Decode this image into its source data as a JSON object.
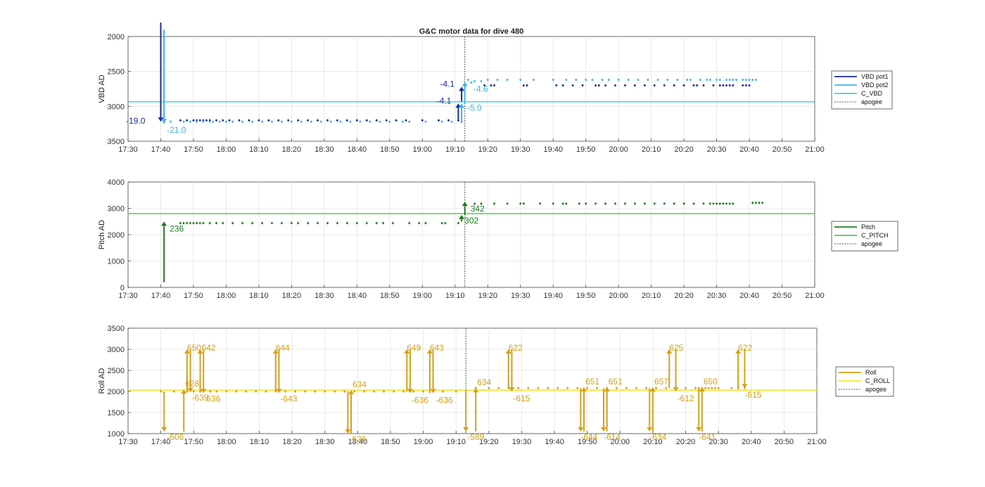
{
  "figure_title": "G&C motor data for dive 480",
  "chart_data": [
    {
      "type": "scatter",
      "ylabel": "VBD AD",
      "ylim": [
        2000,
        3500
      ],
      "y_reversed": true,
      "yticks": [
        "2000",
        "2500",
        "3000",
        "3500"
      ],
      "xticks": [
        "17:30",
        "17:40",
        "17:50",
        "18:00",
        "18:10",
        "18:20",
        "18:30",
        "18:40",
        "18:50",
        "19:00",
        "19:10",
        "19:20",
        "19:30",
        "19:40",
        "19:50",
        "20:00",
        "20:10",
        "20:20",
        "20:30",
        "20:40",
        "20:50",
        "21:00"
      ],
      "xlim_minutes": [
        1050,
        1260
      ],
      "grid": true,
      "legend_entries": [
        "VBD pot1",
        "VBD pot2",
        "C_VBD",
        "apogee"
      ],
      "colors": {
        "pot1": "#1b2aa0",
        "pot2": "#3ab7e8",
        "c": "#47d1d8",
        "apogee": "#555555"
      },
      "c_value": 2935,
      "apogee_minutes": 1153,
      "pot1": {
        "x": [
          1066,
          1068,
          1070,
          1071,
          1072,
          1073,
          1074,
          1075,
          1077,
          1079,
          1081,
          1084,
          1087,
          1090,
          1093,
          1096,
          1099,
          1102,
          1105,
          1108,
          1111,
          1114,
          1117,
          1120,
          1123,
          1126,
          1129,
          1132,
          1135,
          1140,
          1145,
          1148,
          1151,
          1159,
          1161,
          1162,
          1171,
          1172,
          1181,
          1183,
          1186,
          1189,
          1193,
          1194,
          1196,
          1199,
          1202,
          1205,
          1208,
          1211,
          1214,
          1217,
          1220,
          1223,
          1224,
          1226,
          1229,
          1231,
          1232,
          1233,
          1234,
          1235,
          1238,
          1239,
          1240
        ],
        "y": [
          3200,
          3200,
          3200,
          3200,
          3200,
          3200,
          3200,
          3200,
          3200,
          3200,
          3200,
          3200,
          3200,
          3200,
          3200,
          3200,
          3200,
          3200,
          3200,
          3200,
          3200,
          3200,
          3200,
          3200,
          3200,
          3200,
          3200,
          3200,
          3200,
          3200,
          3200,
          3200,
          3200,
          2700,
          2700,
          2700,
          2700,
          2700,
          2700,
          2700,
          2700,
          2700,
          2700,
          2700,
          2700,
          2700,
          2700,
          2700,
          2700,
          2700,
          2700,
          2700,
          2700,
          2700,
          2700,
          2700,
          2700,
          2700,
          2700,
          2700,
          2700,
          2700,
          2700,
          2700,
          2700
        ]
      },
      "pot2": {
        "x": [
          1061,
          1063,
          1067,
          1069,
          1071,
          1073,
          1075,
          1076,
          1078,
          1080,
          1082,
          1085,
          1088,
          1091,
          1094,
          1097,
          1100,
          1103,
          1106,
          1109,
          1112,
          1115,
          1118,
          1121,
          1124,
          1127,
          1130,
          1134,
          1136,
          1141,
          1146,
          1149,
          1152,
          1154,
          1155,
          1156,
          1158,
          1160,
          1163,
          1166,
          1170,
          1174,
          1180,
          1184,
          1187,
          1190,
          1192,
          1195,
          1197,
          1200,
          1203,
          1206,
          1209,
          1212,
          1215,
          1218,
          1221,
          1222,
          1225,
          1227,
          1228,
          1230,
          1231,
          1233,
          1234,
          1235,
          1236,
          1238,
          1239,
          1240,
          1241,
          1242
        ],
        "y": [
          3230,
          3220,
          3220,
          3220,
          3220,
          3220,
          3220,
          3220,
          3220,
          3220,
          3220,
          3220,
          3220,
          3220,
          3220,
          3220,
          3220,
          3220,
          3220,
          3220,
          3220,
          3220,
          3220,
          3220,
          3220,
          3220,
          3220,
          3220,
          3220,
          3220,
          3220,
          3220,
          3220,
          2620,
          2660,
          2640,
          2640,
          2620,
          2620,
          2620,
          2620,
          2620,
          2620,
          2620,
          2620,
          2620,
          2620,
          2620,
          2620,
          2620,
          2620,
          2620,
          2620,
          2620,
          2620,
          2620,
          2620,
          2620,
          2620,
          2620,
          2620,
          2620,
          2620,
          2620,
          2620,
          2620,
          2620,
          2620,
          2620,
          2620,
          2620,
          2620
        ]
      },
      "moves": [
        {
          "series": "pot1",
          "x": 1060,
          "from": 1800,
          "to": 3220,
          "label": "-19.0",
          "lx": -22,
          "ly": 3,
          "anchor": "end"
        },
        {
          "series": "pot2",
          "x": 1061,
          "from": 1900,
          "to": 3240,
          "label": "-21.0",
          "lx": 4,
          "ly": 14,
          "anchor": "start"
        },
        {
          "series": "pot1",
          "x": 1151,
          "from": 3200,
          "to": 2960,
          "label": "-4.1",
          "lx": -10,
          "ly": 0,
          "anchor": "end"
        },
        {
          "series": "pot1",
          "x": 1152,
          "from": 2930,
          "to": 2720,
          "label": "-4.1",
          "lx": -10,
          "ly": 0,
          "anchor": "end"
        },
        {
          "series": "pot2",
          "x": 1152,
          "from": 3240,
          "to": 2960,
          "label": "-5.0",
          "lx": 8,
          "ly": 10,
          "anchor": "start"
        },
        {
          "series": "pot2",
          "x": 1153,
          "from": 2960,
          "to": 2650,
          "label": "-4.6",
          "lx": 12,
          "ly": 14,
          "anchor": "start"
        }
      ]
    },
    {
      "type": "scatter",
      "ylabel": "Pitch AD",
      "ylim": [
        0,
        4000
      ],
      "yticks": [
        "0",
        "1000",
        "2000",
        "3000",
        "4000"
      ],
      "xticks": [
        "17:30",
        "17:40",
        "17:50",
        "18:00",
        "18:10",
        "18:20",
        "18:30",
        "18:40",
        "18:50",
        "19:00",
        "19:10",
        "19:20",
        "19:30",
        "19:40",
        "19:50",
        "20:00",
        "20:10",
        "20:20",
        "20:30",
        "20:40",
        "20:50",
        "21:00"
      ],
      "xlim_minutes": [
        1050,
        1260
      ],
      "grid": true,
      "legend_entries": [
        "Pitch",
        "C_PITCH",
        "apogee"
      ],
      "colors": {
        "pitch": "#1e7d1e",
        "c": "#4fd14f",
        "apogee": "#555555"
      },
      "c_value": 2800,
      "apogee_minutes": 1153,
      "pitch": {
        "x": [
          1066,
          1067,
          1068,
          1069,
          1070,
          1071,
          1072,
          1073,
          1075,
          1077,
          1079,
          1082,
          1085,
          1088,
          1091,
          1094,
          1097,
          1100,
          1102,
          1105,
          1108,
          1111,
          1114,
          1117,
          1120,
          1123,
          1126,
          1128,
          1131,
          1136,
          1139,
          1141,
          1146,
          1147,
          1151,
          1156,
          1158,
          1162,
          1166,
          1170,
          1171,
          1176,
          1180,
          1183,
          1184,
          1188,
          1190,
          1193,
          1196,
          1199,
          1202,
          1205,
          1208,
          1211,
          1214,
          1217,
          1220,
          1223,
          1226,
          1228,
          1229,
          1230,
          1231,
          1232,
          1233,
          1234,
          1235,
          1241,
          1242,
          1243,
          1244
        ],
        "y": [
          2440,
          2440,
          2440,
          2440,
          2440,
          2440,
          2440,
          2440,
          2440,
          2440,
          2440,
          2440,
          2440,
          2440,
          2440,
          2440,
          2440,
          2440,
          2440,
          2440,
          2440,
          2440,
          2440,
          2440,
          2440,
          2440,
          2440,
          2440,
          2440,
          2440,
          2440,
          2440,
          2440,
          2440,
          2440,
          3180,
          3180,
          3180,
          3180,
          3180,
          3180,
          3180,
          3180,
          3180,
          3180,
          3180,
          3180,
          3180,
          3180,
          3180,
          3180,
          3180,
          3180,
          3180,
          3180,
          3180,
          3180,
          3180,
          3180,
          3180,
          3180,
          3180,
          3180,
          3180,
          3180,
          3180,
          3180,
          3210,
          3210,
          3210,
          3210
        ]
      },
      "moves": [
        {
          "x": 1061,
          "from": 200,
          "to": 2500,
          "label": "236",
          "lx": 8,
          "ly": 14,
          "anchor": "start"
        },
        {
          "x": 1152,
          "from": 2500,
          "to": 2750,
          "label": "302",
          "lx": 4,
          "ly": 12,
          "anchor": "start"
        },
        {
          "x": 1153,
          "from": 2750,
          "to": 3250,
          "label": "342",
          "lx": 8,
          "ly": 14,
          "anchor": "start"
        }
      ]
    },
    {
      "type": "scatter",
      "ylabel": "Roll AD",
      "ylim": [
        1000,
        3500
      ],
      "yticks": [
        "1000",
        "1500",
        "2000",
        "2500",
        "3000",
        "3500"
      ],
      "xticks": [
        "17:30",
        "17:40",
        "17:50",
        "18:00",
        "18:10",
        "18:20",
        "18:30",
        "18:40",
        "18:50",
        "19:00",
        "19:10",
        "19:20",
        "19:30",
        "19:40",
        "19:50",
        "20:00",
        "20:10",
        "20:20",
        "20:30",
        "20:40",
        "20:50",
        "21:00"
      ],
      "xlim_minutes": [
        1050,
        1260
      ],
      "grid": true,
      "legend_entries": [
        "Roll",
        "C_ROLL",
        "apogee"
      ],
      "colors": {
        "roll": "#d4a017",
        "c": "#f2e640",
        "apogee": "#555555"
      },
      "c_value": 2030,
      "apogee_minutes": 1153,
      "roll": {
        "x": [
          1060,
          1064,
          1068,
          1070,
          1072,
          1075,
          1077,
          1080,
          1083,
          1086,
          1089,
          1092,
          1095,
          1098,
          1101,
          1104,
          1107,
          1110,
          1113,
          1116,
          1119,
          1122,
          1125,
          1128,
          1131,
          1134,
          1137,
          1140,
          1143,
          1146,
          1150,
          1156,
          1160,
          1163,
          1166,
          1169,
          1172,
          1175,
          1178,
          1181,
          1184,
          1187,
          1190,
          1193,
          1196,
          1199,
          1202,
          1205,
          1208,
          1211,
          1214,
          1217,
          1220,
          1223,
          1224,
          1225,
          1226,
          1227,
          1228,
          1229,
          1230,
          1234,
          1236,
          1238
        ],
        "y": [
          2000,
          2000,
          2000,
          2000,
          2000,
          2000,
          2000,
          2000,
          2000,
          2000,
          2000,
          2000,
          2000,
          2000,
          2000,
          2000,
          2000,
          2000,
          2000,
          2000,
          2000,
          2000,
          2000,
          2000,
          2000,
          2000,
          2000,
          2000,
          2000,
          2000,
          2000,
          2080,
          2080,
          2080,
          2080,
          2080,
          2080,
          2080,
          2080,
          2080,
          2080,
          2080,
          2080,
          2080,
          2080,
          2080,
          2080,
          2080,
          2080,
          2080,
          2080,
          2080,
          2080,
          2080,
          2080,
          2080,
          2080,
          2080,
          2080,
          2080,
          2080,
          2080,
          2080,
          2080
        ]
      },
      "moves": [
        {
          "x": 1061,
          "from": 2000,
          "to": 1050,
          "label": "-606",
          "lx": 4,
          "ly": 12,
          "anchor": "start"
        },
        {
          "x": 1067,
          "from": 1050,
          "to": 2050,
          "label": "628",
          "lx": 2,
          "ly": -4,
          "anchor": "start"
        },
        {
          "x": 1068,
          "from": 2000,
          "to": 3000,
          "label": "650",
          "lx": 0,
          "ly": 2,
          "anchor": "start"
        },
        {
          "x": 1069,
          "from": 3000,
          "to": 1980,
          "label": "-639",
          "lx": 2,
          "ly": 12,
          "anchor": "start"
        },
        {
          "x": 1072,
          "from": 1980,
          "to": 3000,
          "label": "642",
          "lx": 2,
          "ly": 2,
          "anchor": "start"
        },
        {
          "x": 1073,
          "from": 3000,
          "to": 1960,
          "label": "636",
          "lx": 4,
          "ly": 12,
          "anchor": "start"
        },
        {
          "x": 1080,
          "from": 0,
          "to": 0,
          "label": "",
          "lx": 0,
          "ly": 0,
          "anchor": "start",
          "skip": true
        },
        {
          "x": 1095,
          "from": 2000,
          "to": 3000,
          "label": "644",
          "lx": 0,
          "ly": 2,
          "anchor": "start"
        },
        {
          "x": 1096,
          "from": 3000,
          "to": 1960,
          "label": "-643",
          "lx": 2,
          "ly": 12,
          "anchor": "start"
        },
        {
          "x": 1117,
          "from": 2000,
          "to": 1000,
          "label": "-626",
          "lx": 2,
          "ly": 12,
          "anchor": "start"
        },
        {
          "x": 1118,
          "from": 1000,
          "to": 2030,
          "label": "634",
          "lx": 2,
          "ly": -4,
          "anchor": "start"
        },
        {
          "x": 1135,
          "from": 2000,
          "to": 3000,
          "label": "649",
          "lx": 0,
          "ly": 2,
          "anchor": "start"
        },
        {
          "x": 1136,
          "from": 3000,
          "to": 1960,
          "label": "-636",
          "lx": 2,
          "ly": 14,
          "anchor": "start"
        },
        {
          "x": 1142,
          "from": 1960,
          "to": 3000,
          "label": "643",
          "lx": 0,
          "ly": 2,
          "anchor": "start"
        },
        {
          "x": 1143,
          "from": 3000,
          "to": 1960,
          "label": "-636",
          "lx": 4,
          "ly": 14,
          "anchor": "start"
        },
        {
          "x": 1153,
          "from": 2050,
          "to": 1050,
          "label": "-589",
          "lx": 2,
          "ly": 12,
          "anchor": "start"
        },
        {
          "x": 1156,
          "from": 1050,
          "to": 2080,
          "label": "634",
          "lx": 2,
          "ly": -4,
          "anchor": "start"
        },
        {
          "x": 1166,
          "from": 2080,
          "to": 3000,
          "label": "622",
          "lx": 0,
          "ly": 2,
          "anchor": "start"
        },
        {
          "x": 1167,
          "from": 3000,
          "to": 2000,
          "label": "-615",
          "lx": 2,
          "ly": 14,
          "anchor": "start"
        },
        {
          "x": 1188,
          "from": 2080,
          "to": 1050,
          "label": "-644",
          "lx": 0,
          "ly": 12,
          "anchor": "start"
        },
        {
          "x": 1189,
          "from": 1050,
          "to": 2100,
          "label": "651",
          "lx": 2,
          "ly": -4,
          "anchor": "start"
        },
        {
          "x": 1195,
          "from": 2080,
          "to": 1050,
          "label": "-614",
          "lx": 0,
          "ly": 12,
          "anchor": "start"
        },
        {
          "x": 1196,
          "from": 1050,
          "to": 2100,
          "label": "651",
          "lx": 2,
          "ly": -4,
          "anchor": "start"
        },
        {
          "x": 1209,
          "from": 2080,
          "to": 1050,
          "label": "-634",
          "lx": 0,
          "ly": 12,
          "anchor": "start"
        },
        {
          "x": 1210,
          "from": 1050,
          "to": 2100,
          "label": "657",
          "lx": 2,
          "ly": -4,
          "anchor": "start"
        },
        {
          "x": 1215,
          "from": 2080,
          "to": 3000,
          "label": "625",
          "lx": 0,
          "ly": 2,
          "anchor": "start"
        },
        {
          "x": 1217,
          "from": 3000,
          "to": 2000,
          "label": "-612",
          "lx": 2,
          "ly": 14,
          "anchor": "start"
        },
        {
          "x": 1224,
          "from": 2080,
          "to": 1050,
          "label": "-641",
          "lx": 0,
          "ly": 12,
          "anchor": "start"
        },
        {
          "x": 1225,
          "from": 1050,
          "to": 2100,
          "label": "650",
          "lx": 2,
          "ly": -4,
          "anchor": "start"
        },
        {
          "x": 1236,
          "from": 2080,
          "to": 3000,
          "label": "622",
          "lx": 0,
          "ly": 2,
          "anchor": "start"
        },
        {
          "x": 1238,
          "from": 3000,
          "to": 2080,
          "label": "-615",
          "lx": 0,
          "ly": 14,
          "anchor": "start"
        }
      ]
    }
  ]
}
